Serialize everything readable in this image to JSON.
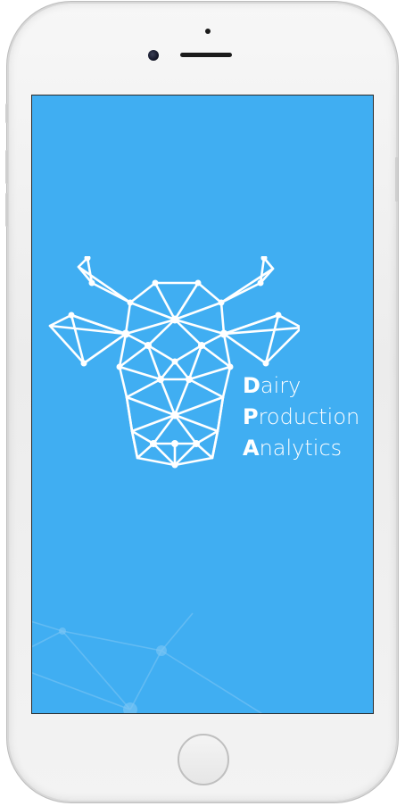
{
  "device": {
    "frame_color": "#f2f2f2",
    "screen_color": "#40aef2"
  },
  "splash": {
    "logo_icon": "geometric-cow-head-icon",
    "title_lines": [
      {
        "initial": "D",
        "rest": "airy"
      },
      {
        "initial": "P",
        "rest": "roduction"
      },
      {
        "initial": "A",
        "rest": "nalytics"
      }
    ],
    "text_color": "#ffffff"
  }
}
